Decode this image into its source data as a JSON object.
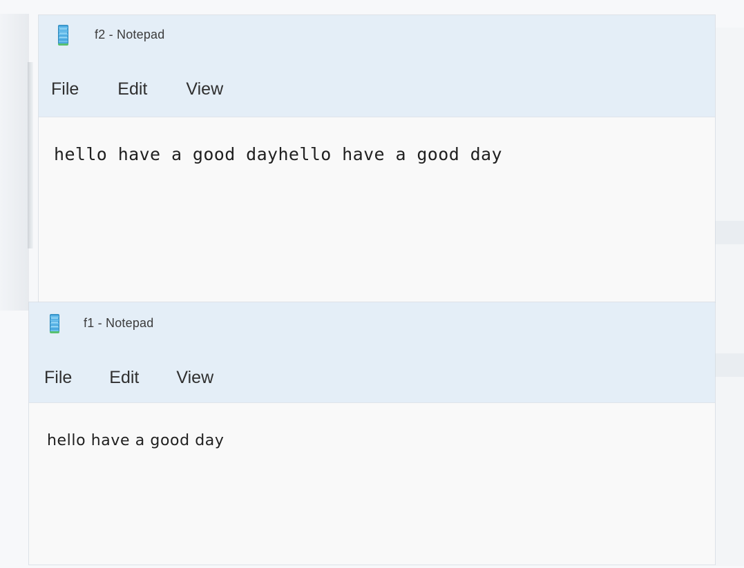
{
  "windows": [
    {
      "title": "f2 - Notepad",
      "menu": {
        "file": "File",
        "edit": "Edit",
        "view": "View"
      },
      "content": "hello have a good dayhello have a good day"
    },
    {
      "title": "f1 - Notepad",
      "menu": {
        "file": "File",
        "edit": "Edit",
        "view": "View"
      },
      "content": "hello have a good day"
    }
  ]
}
